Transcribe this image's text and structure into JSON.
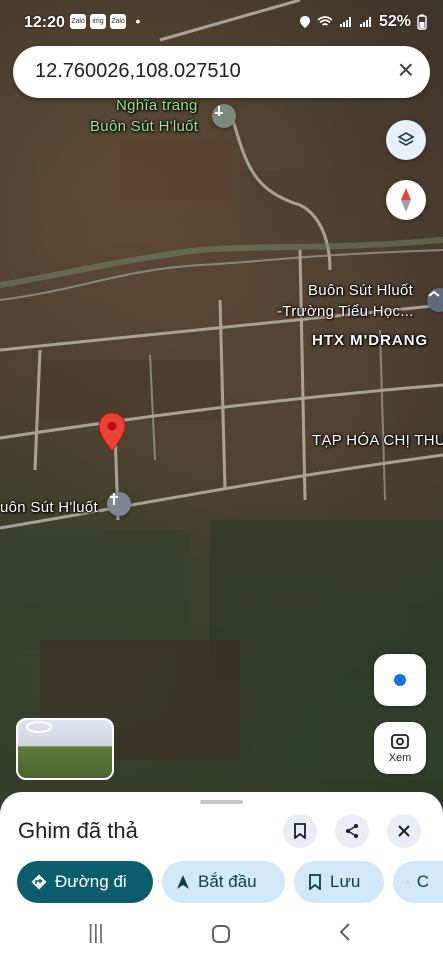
{
  "status_bar": {
    "time": "12:20",
    "apps": [
      "Zalo",
      "img",
      "Zalo"
    ],
    "dot": "•",
    "battery": "52%"
  },
  "search": {
    "query": "12.760026,108.027510",
    "clear_icon": "close-icon"
  },
  "map_labels": {
    "cemetery_line1": "Nghĩa trang",
    "cemetery_line2": "Buôn Sút H'luốt",
    "school_line1": "Buôn Sút Hluốt",
    "school_line2": "-Trường Tiểu Học...",
    "coop": "HTX M'DRANG",
    "shop": "TẠP HÓA CHỊ THU",
    "church": "uôn Sút H'luốt"
  },
  "controls": {
    "layers_icon": "layers-icon",
    "compass_icon": "compass-icon",
    "location_icon": "my-location-icon",
    "xem_label": "Xem"
  },
  "sheet": {
    "title": "Ghim đã thả",
    "chips": [
      {
        "label": "Đường đi",
        "icon": "directions-icon"
      },
      {
        "label": "Bắt đầu",
        "icon": "navigation-icon"
      },
      {
        "label": "Lưu",
        "icon": "bookmark-icon"
      },
      {
        "label": "C",
        "icon": "share-icon"
      }
    ]
  },
  "colors": {
    "accent": "#0b5d6e",
    "chip_bg": "#d3e8f7",
    "pin": "#ea4335",
    "location": "#1a73e8"
  }
}
